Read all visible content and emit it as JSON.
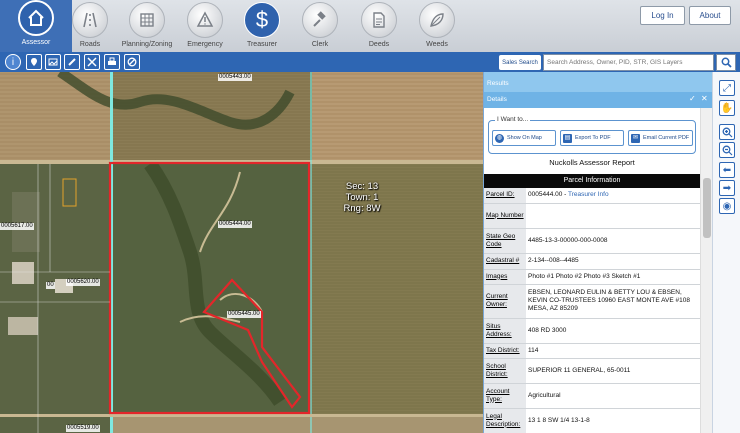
{
  "nav": {
    "items": [
      {
        "label": "Assessor",
        "icon": "home-icon",
        "active": true
      },
      {
        "label": "Roads",
        "icon": "road-icon"
      },
      {
        "label": "Planning/Zoning",
        "icon": "grid-plan-icon"
      },
      {
        "label": "Emergency",
        "icon": "warning-icon"
      },
      {
        "label": "Treasurer",
        "icon": "dollar-icon"
      },
      {
        "label": "Clerk",
        "icon": "gavel-icon"
      },
      {
        "label": "Deeds",
        "icon": "document-icon"
      },
      {
        "label": "Weeds",
        "icon": "leaf-icon"
      }
    ],
    "login": "Log In",
    "about": "About"
  },
  "toolbar": {
    "search_label": "Sales Search",
    "search_placeholder": "Search Address, Owner, PID, STR, GIS Layers"
  },
  "map": {
    "labels": {
      "l1": "0005443.00",
      "l2": "0005444.00",
      "l3": "0005445.00",
      "l4": "0005617.00",
      "l5": "0005620.00",
      "l6": "00",
      "l7": "0005519.00"
    },
    "plss": {
      "line1": "Sec: 13",
      "line2": "Town: 1",
      "line3": "Rng: 8W"
    }
  },
  "panel": {
    "results": "Results",
    "details": "Details",
    "want_title": "I Want to...",
    "buttons": {
      "show_map": "Show On Map",
      "export_pdf": "Export To PDF",
      "email_pdf": "Email Current PDF"
    },
    "report_title": "Nuckolls Assessor Report",
    "section": "Parcel Information",
    "rows": {
      "parcel_id": {
        "key": "Parcel ID:",
        "value": "0005444.00 -",
        "link": "Treasurer Info"
      },
      "map_number": {
        "key": "Map Number",
        "value": ""
      },
      "state_geo": {
        "key": "State Geo Code",
        "value": "4485-13-3-00000-000-0008"
      },
      "cadastral": {
        "key": "Cadastral #",
        "value": "2-134--008--4485"
      },
      "images": {
        "key": "Images",
        "value": "Photo #1 Photo #2 Photo #3 Sketch #1"
      },
      "owner": {
        "key": "Current Owner:",
        "value": "EBSEN, LEONARD EULIN & BETTY LOU & EBSEN, KEVIN CO-TRUSTEES 10960 EAST MONTE AVE #108 MESA, AZ 85209"
      },
      "situs": {
        "key": "Situs Address:",
        "value": "408 RD 3000"
      },
      "tax_district": {
        "key": "Tax District:",
        "value": "114"
      },
      "school": {
        "key": "School District:",
        "value": "SUPERIOR 11 GENERAL, 65-0011"
      },
      "account_type": {
        "key": "Account Type:",
        "value": "Agricultural"
      },
      "legal": {
        "key": "Legal Description:",
        "value": "13 1 8 SW 1/4 13-1-8"
      }
    }
  },
  "colors": {
    "accent": "#2e66b3",
    "parcel_outline": "#e3262a",
    "road_cyan": "#7fe8e0"
  }
}
